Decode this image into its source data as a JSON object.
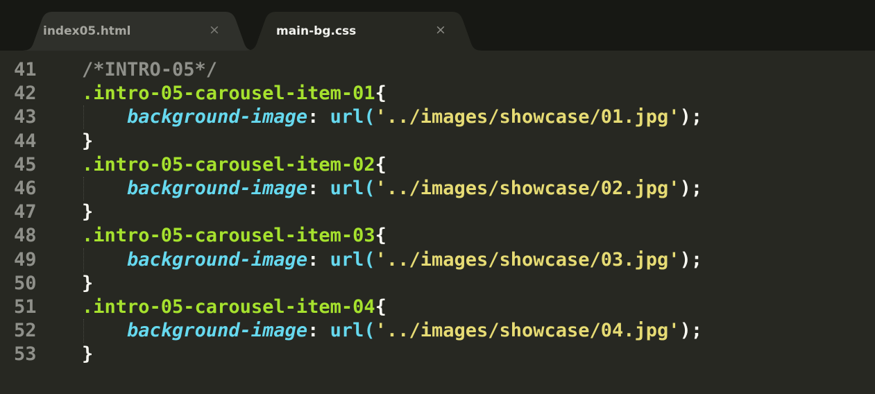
{
  "tabs": [
    {
      "label": "index05.html",
      "close": "×",
      "active": false
    },
    {
      "label": "main-bg.css",
      "close": "×",
      "active": true
    }
  ],
  "editor": {
    "lines": [
      {
        "number": "41",
        "tokens": [
          {
            "t": "/*INTRO-05*/",
            "k": "comment"
          }
        ]
      },
      {
        "number": "42",
        "tokens": [
          {
            "t": ".intro-05-carousel-item-01",
            "k": "selector"
          },
          {
            "t": "{",
            "k": "brace"
          }
        ]
      },
      {
        "number": "43",
        "indent": true,
        "tokens": [
          {
            "t": "background-image",
            "k": "property"
          },
          {
            "t": ": ",
            "k": "punct"
          },
          {
            "t": "url(",
            "k": "func"
          },
          {
            "t": "'../images/showcase/01.jpg'",
            "k": "string"
          },
          {
            "t": ");",
            "k": "punct"
          }
        ]
      },
      {
        "number": "44",
        "tokens": [
          {
            "t": "}",
            "k": "brace"
          }
        ]
      },
      {
        "number": "45",
        "tokens": [
          {
            "t": ".intro-05-carousel-item-02",
            "k": "selector"
          },
          {
            "t": "{",
            "k": "brace"
          }
        ]
      },
      {
        "number": "46",
        "indent": true,
        "tokens": [
          {
            "t": "background-image",
            "k": "property"
          },
          {
            "t": ": ",
            "k": "punct"
          },
          {
            "t": "url(",
            "k": "func"
          },
          {
            "t": "'../images/showcase/02.jpg'",
            "k": "string"
          },
          {
            "t": ");",
            "k": "punct"
          }
        ]
      },
      {
        "number": "47",
        "tokens": [
          {
            "t": "}",
            "k": "brace"
          }
        ]
      },
      {
        "number": "48",
        "tokens": [
          {
            "t": ".intro-05-carousel-item-03",
            "k": "selector"
          },
          {
            "t": "{",
            "k": "brace"
          }
        ]
      },
      {
        "number": "49",
        "indent": true,
        "tokens": [
          {
            "t": "background-image",
            "k": "property"
          },
          {
            "t": ": ",
            "k": "punct"
          },
          {
            "t": "url(",
            "k": "func"
          },
          {
            "t": "'../images/showcase/03.jpg'",
            "k": "string"
          },
          {
            "t": ");",
            "k": "punct"
          }
        ]
      },
      {
        "number": "50",
        "tokens": [
          {
            "t": "}",
            "k": "brace"
          }
        ]
      },
      {
        "number": "51",
        "tokens": [
          {
            "t": ".intro-05-carousel-item-04",
            "k": "selector"
          },
          {
            "t": "{",
            "k": "brace"
          }
        ]
      },
      {
        "number": "52",
        "indent": true,
        "tokens": [
          {
            "t": "background-image",
            "k": "property"
          },
          {
            "t": ": ",
            "k": "punct"
          },
          {
            "t": "url(",
            "k": "func"
          },
          {
            "t": "'../images/showcase/04.jpg'",
            "k": "string"
          },
          {
            "t": ");",
            "k": "punct"
          }
        ]
      },
      {
        "number": "53",
        "tokens": [
          {
            "t": "}",
            "k": "brace"
          }
        ]
      }
    ]
  },
  "colors": {
    "editor_background": "#272822",
    "tabbar_background": "#171814",
    "active_tab": "#272822",
    "inactive_tab": "#2F302B",
    "comment": "#8F908A",
    "selector": "#A6E22E",
    "property": "#66D9EF",
    "string": "#E6DB74",
    "punctuation": "#F8F8F2"
  }
}
